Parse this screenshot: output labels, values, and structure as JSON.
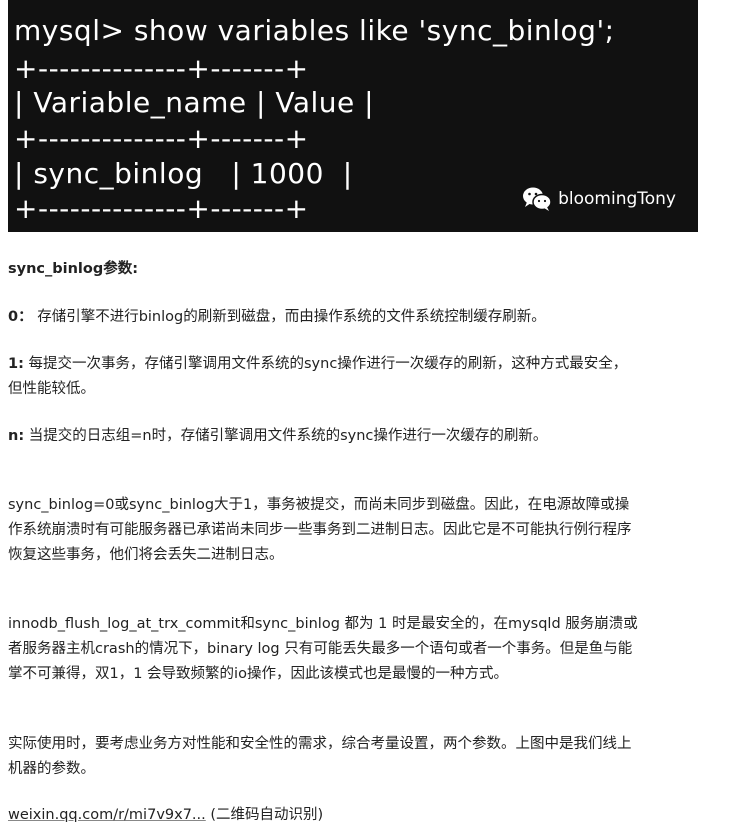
{
  "terminal": {
    "lines": [
      "mysql> show variables like 'sync_binlog';",
      "+--------------+-------+",
      "| Variable_name | Value |",
      "+--------------+-------+",
      "| sync_binlog   | 1000  |",
      "+--------------+-------+"
    ],
    "watermark": "bloomingTony"
  },
  "article": {
    "heading": "sync_binlog参数:",
    "item0_key": "0：",
    "item0_text": "存储引擎不进行binlog的刷新到磁盘，而由操作系统的文件系统控制缓存刷新。",
    "item1_key": "1:",
    "item1_text_a": "每提交一次事务，存储引擎调用文件系统的sync操作进行一次缓存的刷新，这种方式最安全，",
    "item1_text_b": "但性能较低。",
    "itemn_key": "n:",
    "itemn_text": "当提交的日志组=n时，存储引擎调用文件系统的sync操作进行一次缓存的刷新。",
    "para1": [
      "sync_binlog=0或sync_binlog大于1，事务被提交，而尚未同步到磁盘。因此，在电源故障或操",
      "作系统崩溃时有可能服务器已承诺尚未同步一些事务到二进制日志。因此它是不可能执行例行程序",
      "恢复这些事务，他们将会丢失二进制日志。"
    ],
    "para2": [
      "innodb_flush_log_at_trx_commit和sync_binlog 都为 1 时是最安全的，在mysqld 服务崩溃或",
      "者服务器主机crash的情况下，binary log 只有可能丢失最多一个语句或者一个事务。但是鱼与能",
      "掌不可兼得，双1，1 会导致频繁的io操作，因此该模式也是最慢的一种方式。"
    ],
    "para3": [
      "实际使用时，要考虑业务方对性能和安全性的需求，综合考量设置，两个参数。上图中是我们线上",
      "机器的参数。"
    ],
    "link_text": "weixin.qq.com/r/mi7v9x7...",
    "link_note": " (二维码自动识别)"
  }
}
